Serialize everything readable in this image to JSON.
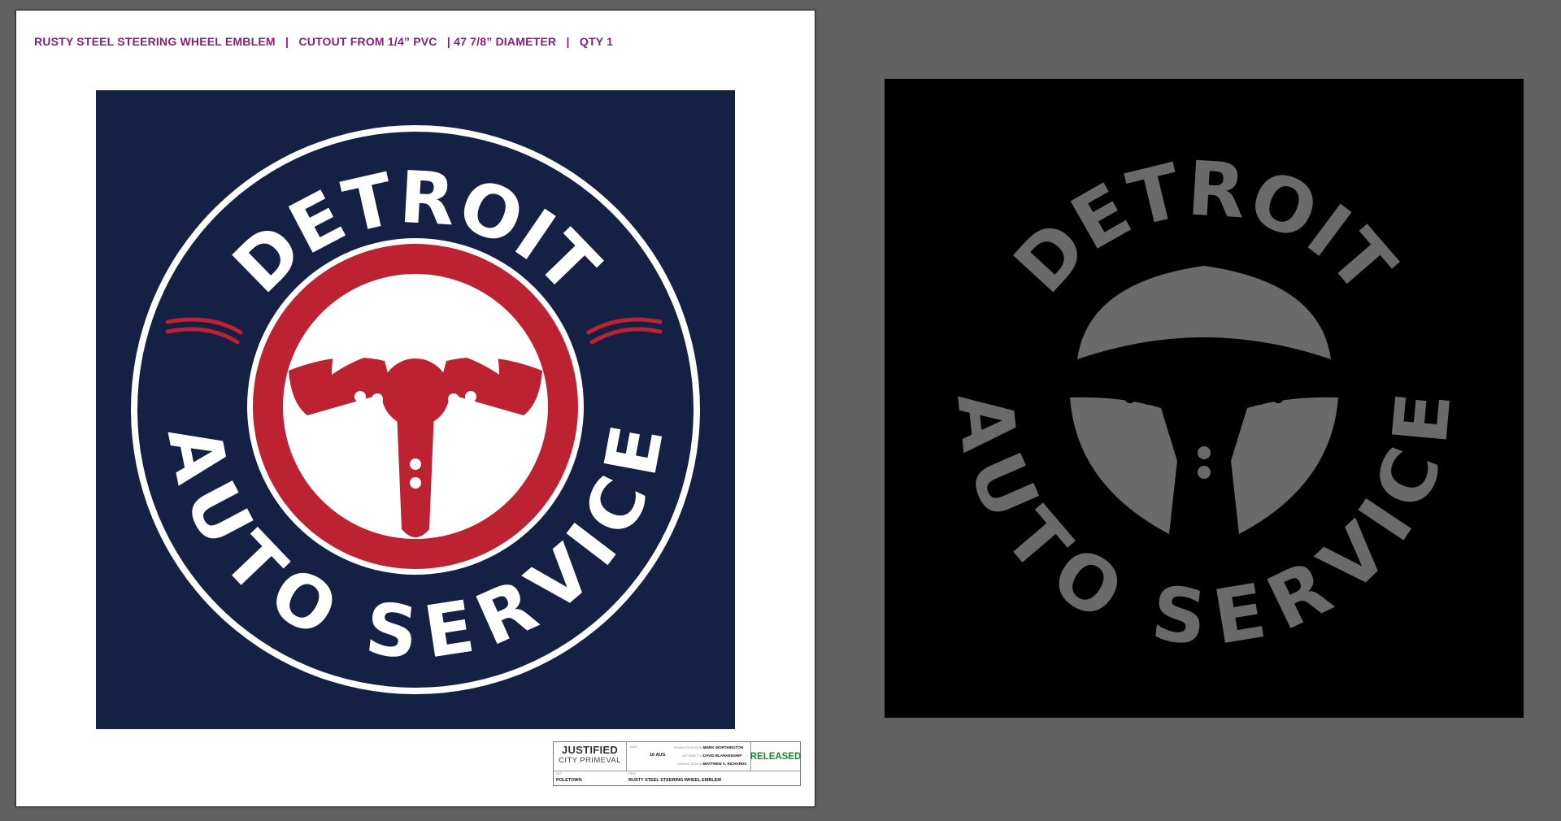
{
  "sheet": {
    "spec_line": "RUSTY STEEL STEERING WHEEL EMBLEM   |   CUTOUT FROM 1/4” PVC   | 47 7/8” DIAMETER   |   QTY 1"
  },
  "emblem": {
    "top_text": "DETROIT",
    "bottom_text": "AUTO SERVICE",
    "colors": {
      "field": "#152045",
      "red": "#bc2231",
      "white": "#ffffff",
      "cutout_gray": "#6a6a6a",
      "cutout_bg": "#000000"
    }
  },
  "title_block": {
    "show_name": "JUSTIFIED",
    "show_subtitle": "CITY PRIMEVAL",
    "date_label": "DATE",
    "date": "16 AUG",
    "designer_label": "PRODUCTION DESIGNER",
    "designer": "MARK WORTHINGTON",
    "art_director_label": "ART DIRECTOR",
    "art_director": "DAVID BLANKENSHIP",
    "graphic_designer_label": "GRAPHIC DESIGNER",
    "graphic_designer": "MATTHEW A. RICHARDS",
    "set_label": "SET",
    "set": "POLETOWN",
    "item_label": "ITEM",
    "item": "RUSTY STEEL STEERING WHEEL EMBLEM",
    "status": "RELEASED"
  }
}
